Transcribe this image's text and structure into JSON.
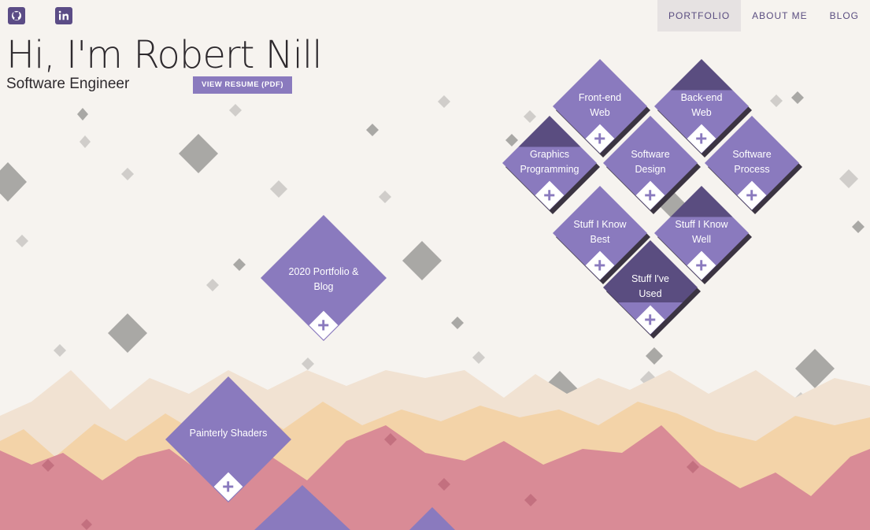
{
  "social": {
    "github_icon": "github-icon",
    "linkedin_icon": "linkedin-icon",
    "icon_color": "#5b4c86"
  },
  "nav": {
    "items": [
      "PORTFOLIO",
      "ABOUT ME",
      "BLOG"
    ],
    "active": "PORTFOLIO"
  },
  "hero": {
    "title": "Hi, I'm Robert Nill",
    "subtitle": "Software Engineer",
    "resume_label": "VIEW RESUME (PDF)"
  },
  "colors": {
    "tile": "#8a7abe",
    "tile_dark": "#5a4d80",
    "background": "#f6f3ef",
    "mountain_back": "#f1e2d2",
    "mountain_mid": "#f3d3a8",
    "mountain_front": "#d98b96",
    "scatter": "#a9a8a5"
  },
  "tiles": [
    {
      "label1": "Front-end",
      "label2": "Web"
    },
    {
      "label1": "Back-end",
      "label2": "Web"
    },
    {
      "label1": "Graphics",
      "label2": "Programming"
    },
    {
      "label1": "Software",
      "label2": "Design"
    },
    {
      "label1": "Software",
      "label2": "Process"
    },
    {
      "label1": "Stuff I Know",
      "label2": "Best"
    },
    {
      "label1": "Stuff I Know",
      "label2": "Well"
    },
    {
      "label1": "Stuff I've",
      "label2": "Used"
    },
    {
      "label1": "2020 Portfolio &",
      "label2": "Blog"
    },
    {
      "label1": "Painterly Shaders",
      "label2": ""
    }
  ],
  "plus_icon": "plus-icon"
}
